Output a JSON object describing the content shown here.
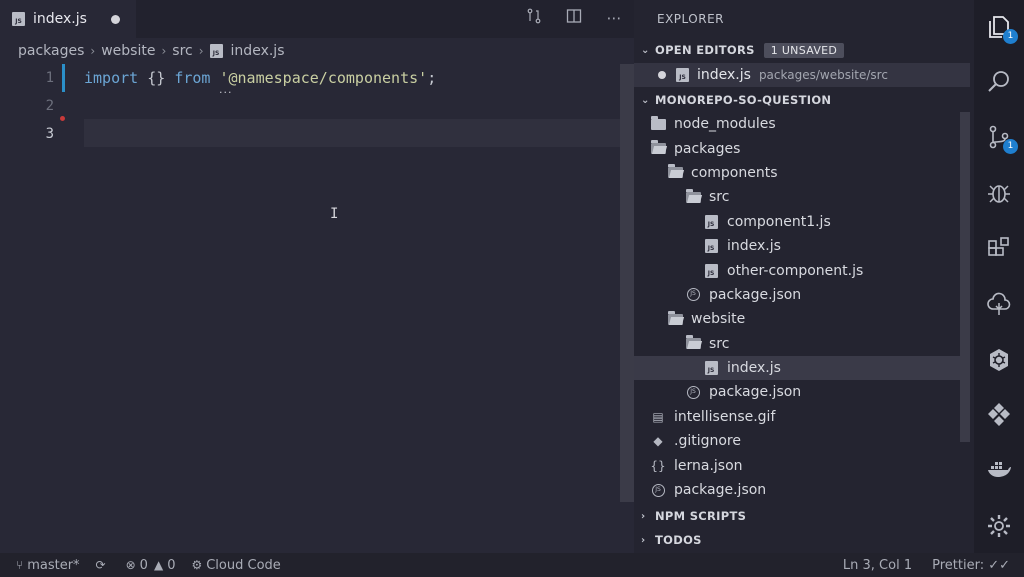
{
  "tab": {
    "label": "index.js",
    "badge": "JS"
  },
  "breadcrumb": [
    "packages",
    "website",
    "src",
    "index.js"
  ],
  "editor": {
    "line_numbers": [
      "1",
      "2",
      "3"
    ],
    "code": {
      "kw_import": "import",
      "braces": "{}",
      "kw_from": "from",
      "string": "'@namespace/components'",
      "semi": ";"
    },
    "hint_dots": "..."
  },
  "explorer": {
    "title": "EXPLORER",
    "open_editors": {
      "label": "OPEN EDITORS",
      "badge": "1 UNSAVED",
      "file": "index.js",
      "path": "packages/website/src"
    },
    "project": {
      "label": "MONOREPO-SO-QUESTION"
    },
    "tree": [
      {
        "label": "node_modules",
        "type": "folder"
      },
      {
        "label": "packages",
        "type": "folder-open"
      },
      {
        "label": "components",
        "type": "folder-open"
      },
      {
        "label": "src",
        "type": "folder-open"
      },
      {
        "label": "component1.js",
        "type": "js"
      },
      {
        "label": "index.js",
        "type": "js"
      },
      {
        "label": "other-component.js",
        "type": "js"
      },
      {
        "label": "package.json",
        "type": "json"
      },
      {
        "label": "website",
        "type": "folder-open"
      },
      {
        "label": "src",
        "type": "folder-open"
      },
      {
        "label": "index.js",
        "type": "js",
        "selected": true
      },
      {
        "label": "package.json",
        "type": "json"
      },
      {
        "label": "intellisense.gif",
        "type": "image"
      },
      {
        "label": ".gitignore",
        "type": "git"
      },
      {
        "label": "lerna.json",
        "type": "braces"
      },
      {
        "label": "package.json",
        "type": "json"
      }
    ],
    "npm_scripts": "NPM SCRIPTS",
    "todos": "TODOS"
  },
  "activity_badges": {
    "explorer": "1",
    "scm": "1"
  },
  "status": {
    "branch": "master*",
    "errors": "0",
    "warnings": "0",
    "cloud": "Cloud Code",
    "position": "Ln 3, Col 1",
    "prettier": "Prettier: ✓✓"
  }
}
